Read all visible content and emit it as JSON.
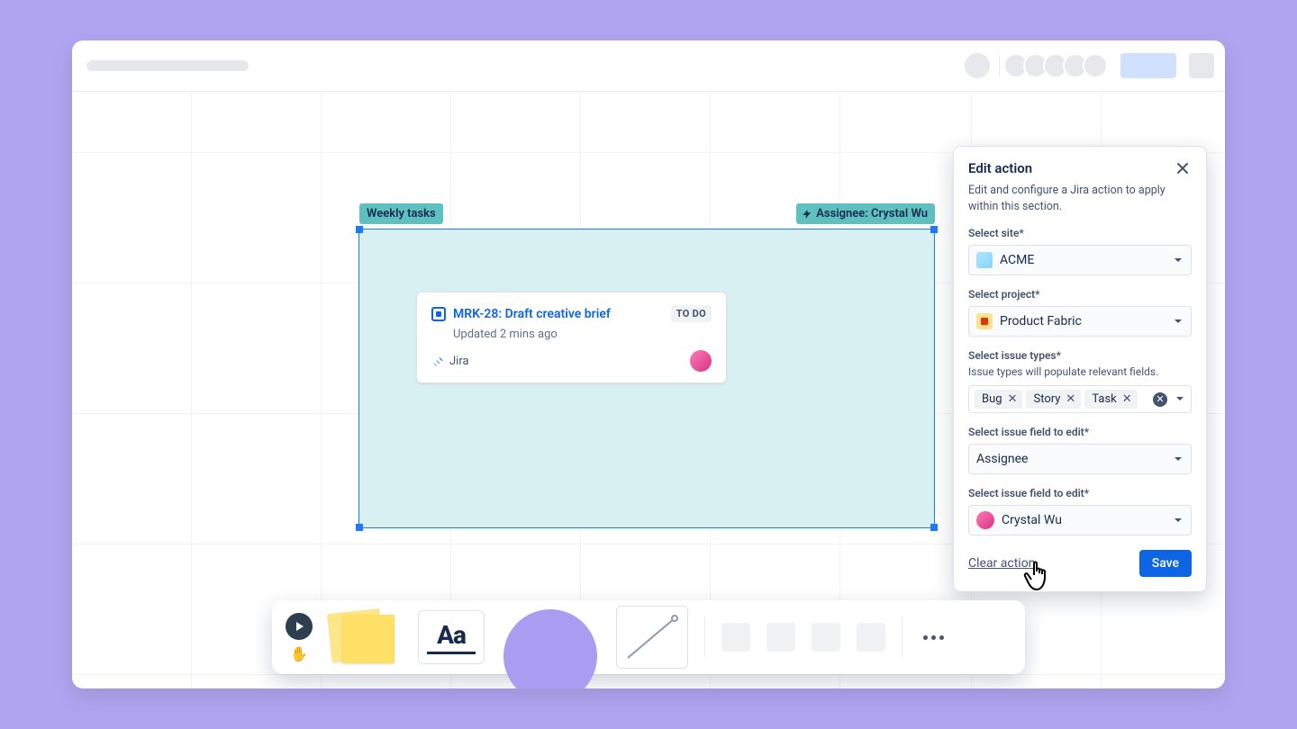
{
  "canvas": {
    "section_label": "Weekly tasks",
    "action_chip": "Assignee: Crystal Wu"
  },
  "card": {
    "title": "MRK-28: Draft creative brief",
    "status": "TO DO",
    "updated": "Updated 2 mins ago",
    "source": "Jira"
  },
  "panel": {
    "title": "Edit action",
    "description": "Edit and configure a Jira action to apply within this section.",
    "fields": {
      "site_label": "Select site*",
      "site_value": "ACME",
      "project_label": "Select project*",
      "project_value": "Product Fabric",
      "issue_types_label": "Select issue types*",
      "issue_types_help": "Issue types will populate relevant fields.",
      "issue_types": {
        "0": "Bug",
        "1": "Story",
        "2": "Task"
      },
      "field_to_edit_label": "Select issue field to edit*",
      "field_to_edit_value": "Assignee",
      "field_value_label": "Select issue field to edit*",
      "field_value_value": "Crystal Wu"
    },
    "clear_label": "Clear action",
    "save_label": "Save"
  },
  "toolbar": {
    "text_tool": "Aa"
  }
}
